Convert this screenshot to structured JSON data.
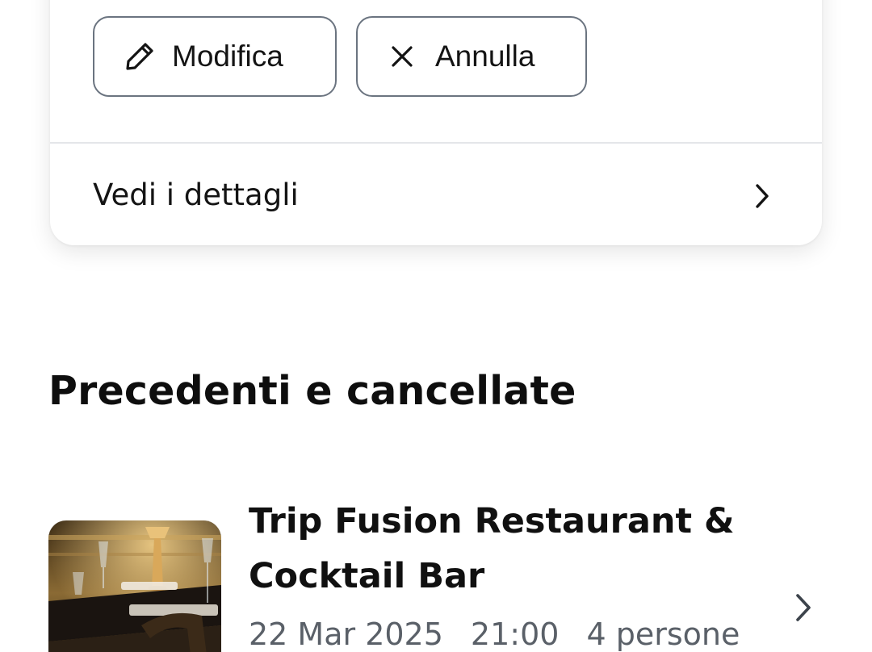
{
  "reservation_card": {
    "edit_label": "Modifica",
    "edit_icon": "pencil-icon",
    "cancel_label": "Annulla",
    "cancel_icon": "close-icon",
    "details_label": "Vedi i dettagli",
    "details_icon": "chevron-right-icon"
  },
  "past_section": {
    "title": "Precedenti e cancellate",
    "items": [
      {
        "name": "Trip Fusion Restaurant & Cocktail Bar",
        "date": "22 Mar 2025",
        "time": "21:00",
        "party": "4 persone",
        "image": "restaurant-interior-photo",
        "chevron_icon": "chevron-right-icon"
      }
    ]
  },
  "colors": {
    "text_primary": "#111111",
    "text_secondary": "#5a6068",
    "button_border": "#6b7480",
    "divider": "#e4e6e9"
  }
}
